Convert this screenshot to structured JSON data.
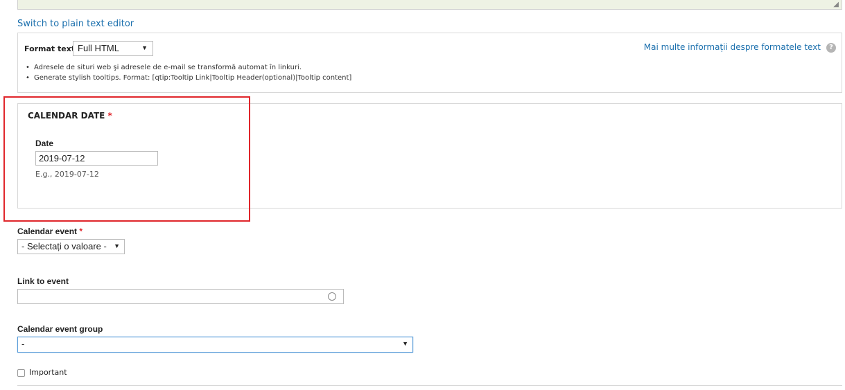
{
  "editor": {
    "switch_link": "Switch to plain text editor"
  },
  "format": {
    "label": "Format text",
    "selected": "Full HTML",
    "more_info": "Mai multe informații despre formatele text",
    "tips": [
      "Adresele de situri web şi adresele de e-mail se transformă automat în linkuri.",
      "Generate stylish tooltips. Format: [qtip:Tooltip Link|Tooltip Header(optional)|Tooltip content]"
    ]
  },
  "calendar_date": {
    "legend": "CALENDAR DATE",
    "required_mark": "*",
    "date_label": "Date",
    "date_value": "2019-07-12",
    "description": "E.g., 2019-07-12"
  },
  "calendar_event": {
    "label": "Calendar event",
    "required_mark": "*",
    "selected": "- Selectați o valoare -"
  },
  "link_to_event": {
    "label": "Link to event",
    "value": ""
  },
  "calendar_event_group": {
    "label": "Calendar event group",
    "selected": "-"
  },
  "important": {
    "label": "Important",
    "checked": false
  },
  "colors": {
    "link": "#1a6fad",
    "required": "#e0262b",
    "highlight": "#e0262b",
    "focus": "#5b9dd9"
  }
}
